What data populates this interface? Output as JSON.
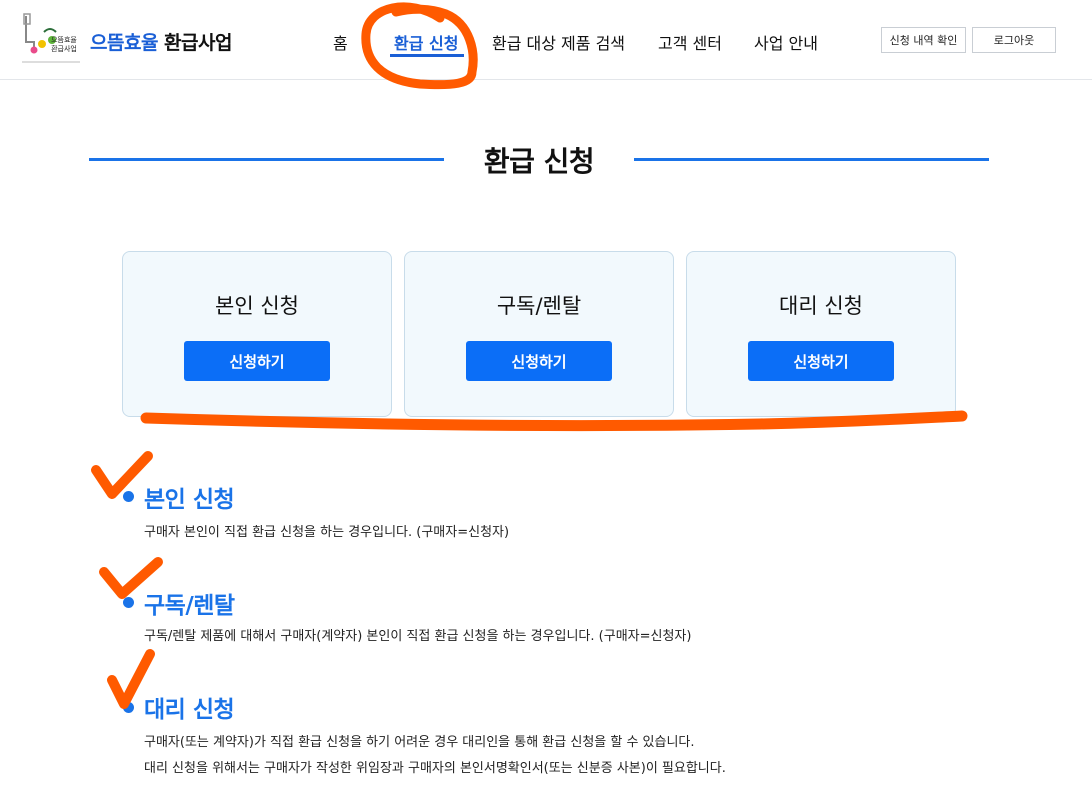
{
  "header": {
    "brand_accent": "으뜸효율",
    "brand_rest": "환급사업",
    "logo_text_top": "으뜸효율",
    "logo_text_bottom": "환급사업",
    "nav": {
      "home": "홈",
      "apply": "환급 신청",
      "search": "환급 대상 제품 검색",
      "support": "고객 센터",
      "about": "사업 안내"
    },
    "check_history_label": "신청 내역 확인",
    "logout_label": "로그아웃"
  },
  "page_title": "환급 신청",
  "cards": {
    "self": {
      "title": "본인 신청",
      "button": "신청하기"
    },
    "rental": {
      "title": "구독/렌탈",
      "button": "신청하기"
    },
    "proxy": {
      "title": "대리 신청",
      "button": "신청하기"
    }
  },
  "sections": {
    "self": {
      "heading": "본인 신청",
      "desc": "구매자 본인이 직접 환급 신청을 하는 경우입니다. (구매자=신청자)"
    },
    "rental": {
      "heading": "구독/렌탈",
      "desc": "구독/렌탈 제품에 대해서 구매자(계약자) 본인이 직접 환급 신청을 하는 경우입니다. (구매자=신청자)"
    },
    "proxy": {
      "heading": "대리 신청",
      "desc_line1": "구매자(또는 계약자)가 직접 환급 신청을 하기 어려운 경우 대리인을 통해 환급 신청을 할 수 있습니다.",
      "desc_line2": "대리 신청을 위해서는 구매자가 작성한 위임장과 구매자의 본인서명확인서(또는 신분증 사본)이 필요합니다."
    }
  },
  "colors": {
    "accent_blue": "#1a73e8",
    "button_blue": "#0b6ef7",
    "annotation_orange": "#ff5a00"
  }
}
